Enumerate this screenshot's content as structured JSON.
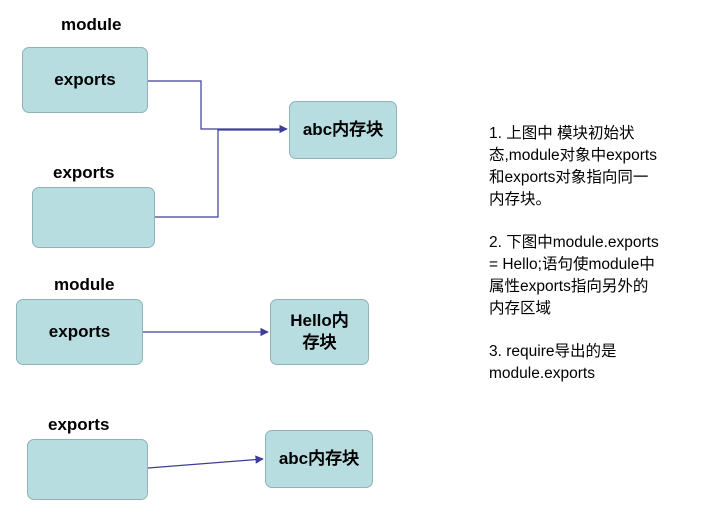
{
  "diagram": {
    "top": {
      "module_label": "module",
      "module_exports_box": "exports",
      "exports_label": "exports",
      "exports_box": "",
      "target_box": "abc内存块"
    },
    "middle": {
      "module_label": "module",
      "module_exports_box": "exports",
      "target_box": "Hello内\n存块"
    },
    "bottom": {
      "exports_label": "exports",
      "exports_box": "",
      "target_box": "abc内存块"
    },
    "colors": {
      "box_fill": "#b7dde0",
      "box_border": "#8fb3b8",
      "arrow": "#3d3d9a"
    }
  },
  "notes": [
    "1. 上图中 模块初始状\n态,module对象中exports\n和exports对象指向同一\n内存块。",
    "2. 下图中module.exports\n= Hello;语句使module中\n属性exports指向另外的\n内存区域",
    "3. require导出的是\nmodule.exports"
  ]
}
